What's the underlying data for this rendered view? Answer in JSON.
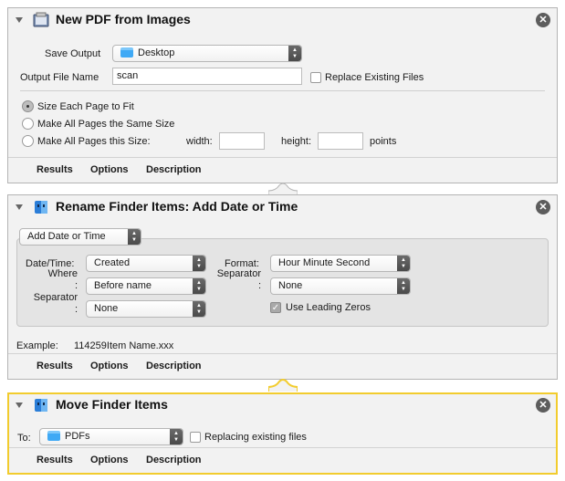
{
  "colors": {
    "active_border": "#f2cc2e",
    "card_bg": "#f2f2f2",
    "folder": "#3fa9f5"
  },
  "actions": [
    {
      "title": "New PDF from Images",
      "icon": "pdf-images-icon",
      "save_output_label": "Save Output",
      "save_output_value": "Desktop",
      "output_file_name_label": "Output File Name",
      "output_file_name_value": "scan",
      "replace_existing_label": "Replace Existing Files",
      "replace_existing_checked": false,
      "radio_options": [
        {
          "label": "Size Each Page to Fit",
          "selected": true
        },
        {
          "label": "Make All Pages the Same Size",
          "selected": false
        },
        {
          "label": "Make All Pages this Size:",
          "selected": false
        }
      ],
      "width_label": "width:",
      "width_value": "",
      "height_label": "height:",
      "height_value": "",
      "units_label": "points",
      "footer": [
        "Results",
        "Options",
        "Description"
      ]
    },
    {
      "title": "Rename Finder Items: Add Date or Time",
      "icon": "finder-icon",
      "mode_value": "Add Date or Time",
      "date_time_label": "Date/Time:",
      "date_time_value": "Created",
      "where_label": "Where\n:",
      "where_value": "Before name",
      "separator_label": "Separator\n:",
      "separator_value": "None",
      "format_label": "Format:",
      "format_value": "Hour Minute Second",
      "separator2_label": "Separator\n:",
      "separator2_value": "None",
      "leading_zeros_label": "Use Leading Zeros",
      "leading_zeros_checked": true,
      "example_label": "Example:",
      "example_value": "114259Item Name.xxx",
      "footer": [
        "Results",
        "Options",
        "Description"
      ]
    },
    {
      "title": "Move Finder Items",
      "icon": "finder-icon",
      "to_label": "To:",
      "to_value": "PDFs",
      "replacing_label": "Replacing existing files",
      "replacing_checked": false,
      "footer": [
        "Results",
        "Options",
        "Description"
      ]
    }
  ]
}
